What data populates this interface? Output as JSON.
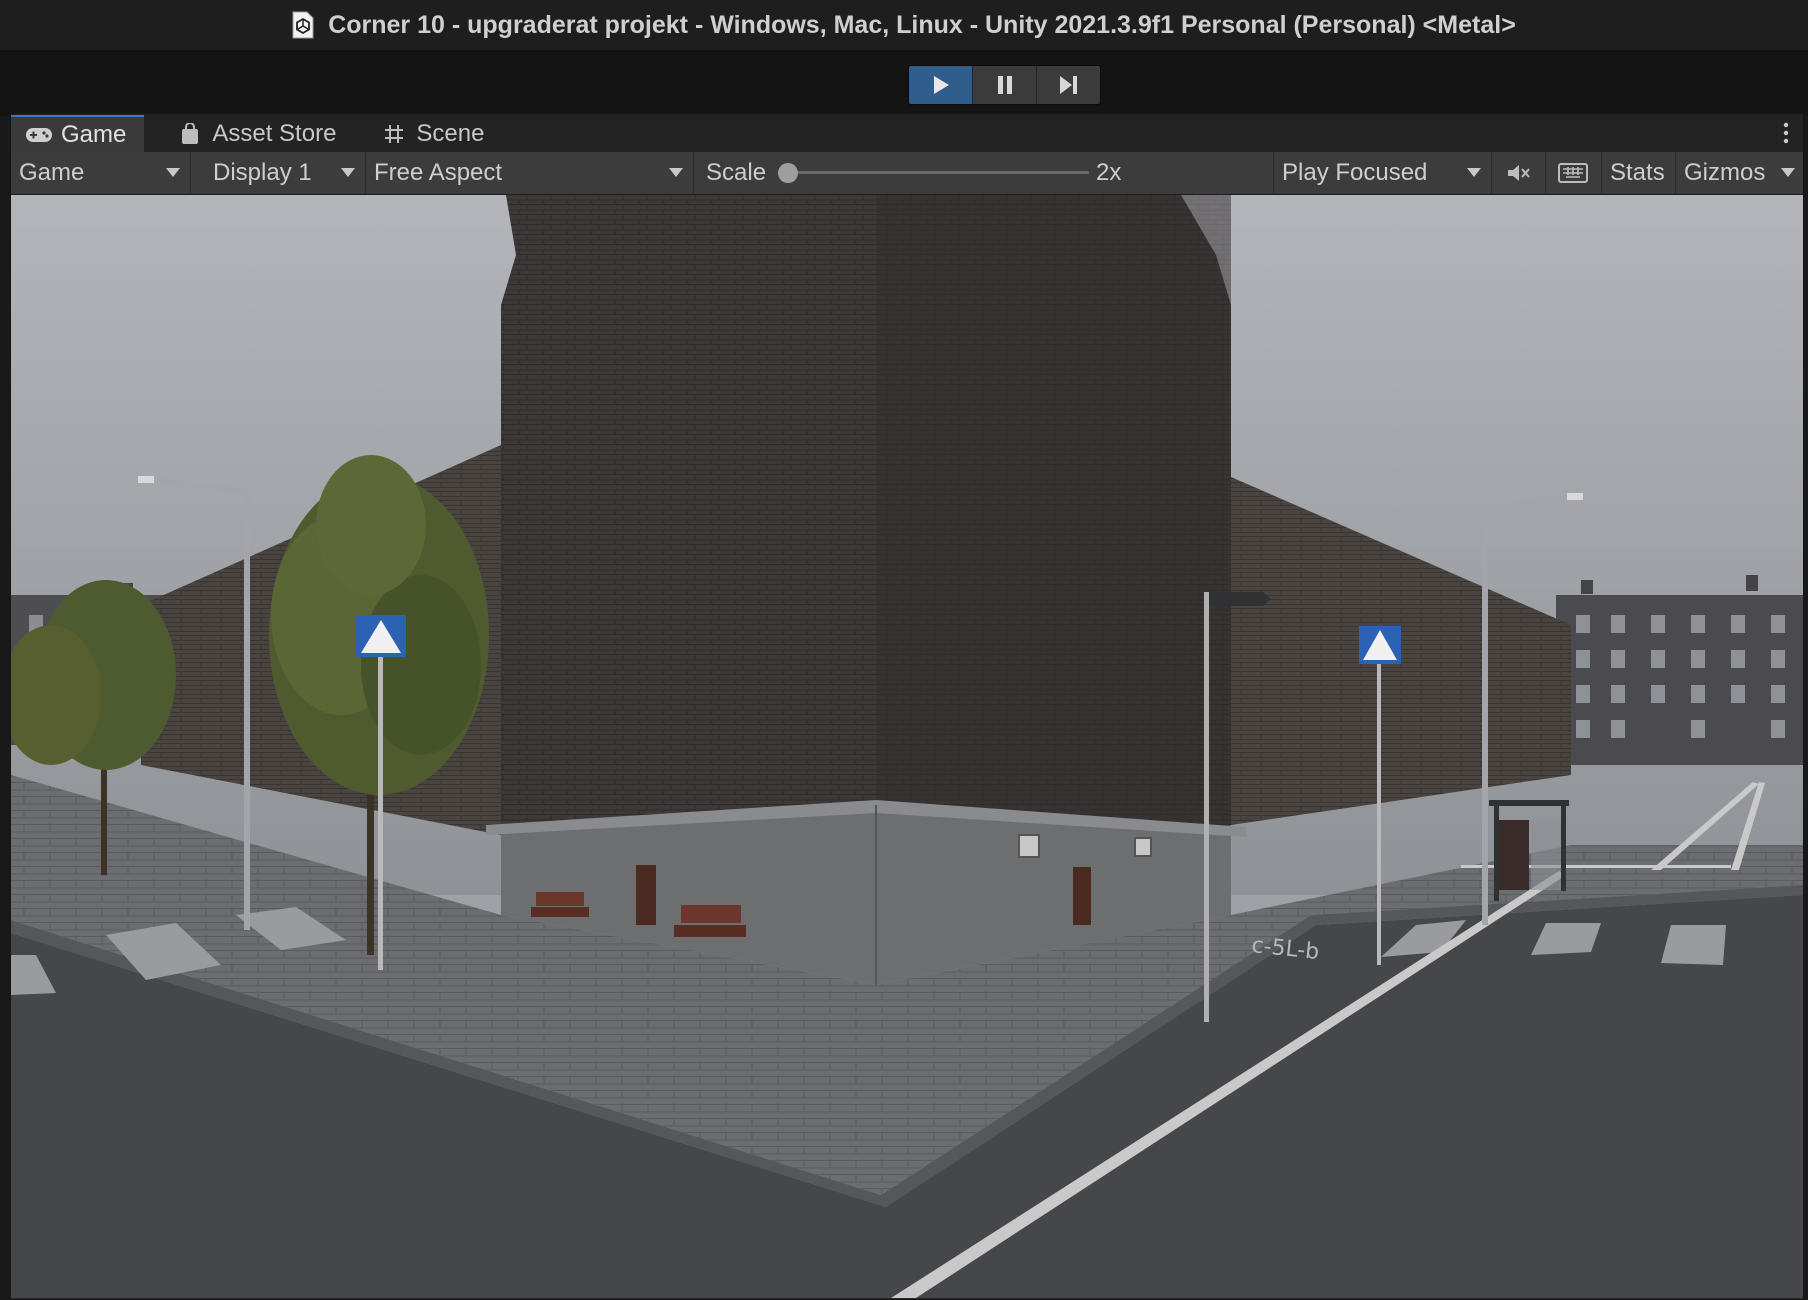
{
  "window": {
    "title": "Corner 10 - upgraderat projekt - Windows, Mac, Linux - Unity 2021.3.9f1 Personal (Personal) <Metal>"
  },
  "playbar": {
    "play_state": "playing"
  },
  "tabs": [
    {
      "label": "Game",
      "icon": "gamepad-icon",
      "active": true
    },
    {
      "label": "Asset Store",
      "icon": "shopping-bag-icon",
      "active": false
    },
    {
      "label": "Scene",
      "icon": "grid-hash-icon",
      "active": false
    }
  ],
  "toolbar": {
    "view_select": "Game",
    "display_select": "Display 1",
    "aspect_select": "Free Aspect",
    "scale_label": "Scale",
    "scale_value": "2x",
    "play_mode_select": "Play Focused",
    "stats_label": "Stats",
    "gizmos_label": "Gizmos"
  },
  "colors": {
    "accent": "#3a79bb",
    "play_active": "#2f5d8c",
    "toolbar_bg": "#3c3c3c"
  }
}
